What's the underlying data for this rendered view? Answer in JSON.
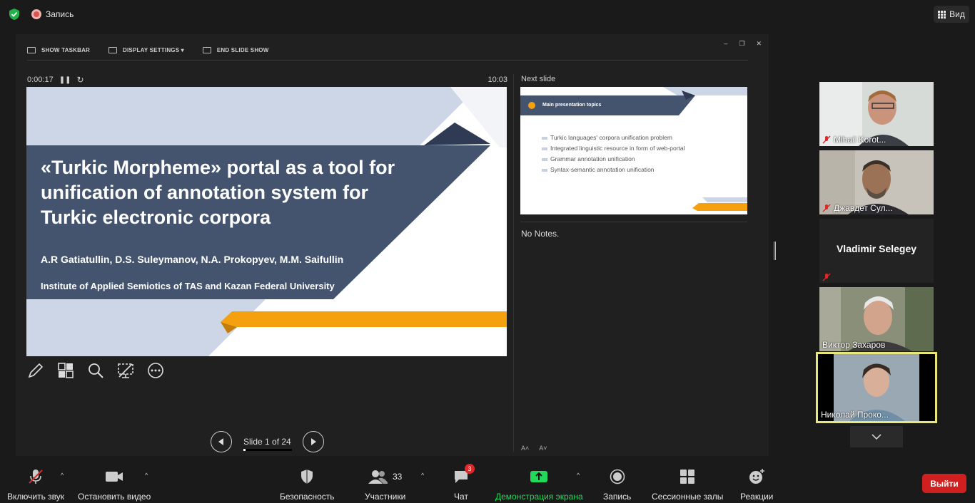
{
  "topbar": {
    "recording_label": "Запись",
    "view_label": "Вид"
  },
  "presenter_toolbar": {
    "show_taskbar": "SHOW TASKBAR",
    "display_settings": "DISPLAY SETTINGS ▾",
    "end_slide_show": "END SLIDE SHOW"
  },
  "presenter": {
    "elapsed": "0:00:17",
    "clock": "10:03",
    "next_slide_label": "Next slide",
    "notes": "No Notes.",
    "slide_counter": "Slide 1 of 24",
    "slide_progress": 0.04
  },
  "current_slide": {
    "title": "«Turkic Morpheme» portal as a tool for unification of annotation system for Turkic electronic corpora",
    "authors": "A.R Gatiatullin, D.S. Suleymanov, N.A. Prokopyev, M.M. Saifullin",
    "institution": "Institute of Applied Semiotics of TAS and Kazan Federal University"
  },
  "next_slide": {
    "title": "Main presentation topics",
    "bullets": [
      "Turkic languages' corpora unification problem",
      "Integrated linguistic resource in form of web-portal",
      "Grammar annotation unification",
      "Syntax-semantic annotation unification"
    ]
  },
  "participants": [
    {
      "name": "Mihail Korot...",
      "muted": true
    },
    {
      "name": "Джавдет Сул...",
      "muted": true
    },
    {
      "name": "Vladimir Selegey",
      "muted": true
    },
    {
      "name": "Виктор Захаров",
      "muted": false
    },
    {
      "name": "Николай Проко...",
      "muted": false,
      "active": true
    }
  ],
  "bottombar": {
    "unmute": "Включить звук",
    "stop_video": "Остановить видео",
    "security": "Безопасность",
    "participants": "Участники",
    "participants_count": "33",
    "chat": "Чат",
    "chat_badge": "3",
    "share_screen": "Демонстрация экрана",
    "record": "Запись",
    "breakout": "Сессионные залы",
    "reactions": "Реакции",
    "leave": "Выйти"
  },
  "colors": {
    "slide_navy": "#44546f",
    "slide_orange": "#f5a00f",
    "slide_light": "#cdd6e6",
    "share_green": "#23d959",
    "leave_red": "#cf1f1f"
  }
}
